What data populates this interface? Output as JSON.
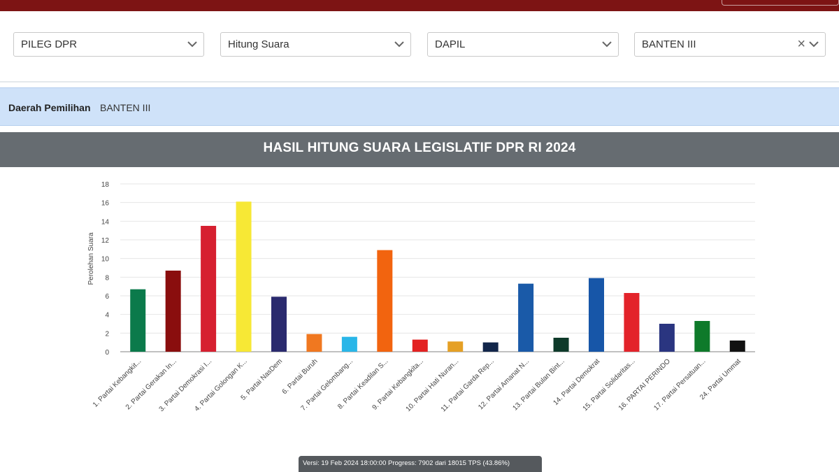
{
  "filters": [
    {
      "value": "PILEG DPR",
      "clearable": false
    },
    {
      "value": "Hitung Suara",
      "clearable": false
    },
    {
      "value": "DAPIL",
      "clearable": false
    },
    {
      "value": "BANTEN III",
      "clearable": true
    }
  ],
  "dapil": {
    "label": "Daerah Pemilihan",
    "value": "BANTEN III"
  },
  "title": "HASIL HITUNG SUARA LEGISLATIF DPR RI 2024",
  "chart_data": {
    "type": "bar",
    "ylabel": "Perolehan Suara",
    "xlabel": "",
    "ylim": [
      0,
      18
    ],
    "yticks": [
      0,
      2,
      4,
      6,
      8,
      10,
      12,
      14,
      16,
      18
    ],
    "grid": true,
    "categories": [
      "1. Partai Kebangkit...",
      "2. Partai Gerakan In...",
      "3. Partai Demokrasi I...",
      "4. Partai Golongan K...",
      "5. Partai NasDem",
      "6. Partai Buruh",
      "7. Partai Gelombang...",
      "8. Partai Keadilan S...",
      "9. Partai Kebangkita...",
      "10. Partai Hati Nuran...",
      "11. Partai Garda Rep...",
      "12. Partai Amanat N...",
      "13. Partai Bulan Bint...",
      "14. Partai Demokrat",
      "15. Partai Solidaritas...",
      "16. PARTAI PERINDO",
      "17. Partai Persatuan...",
      "24. Partai Ummat"
    ],
    "values": [
      6.7,
      8.7,
      13.5,
      16.1,
      5.9,
      1.9,
      1.6,
      10.9,
      1.3,
      1.1,
      1.0,
      7.3,
      1.5,
      7.9,
      6.3,
      3.0,
      3.3,
      1.2
    ],
    "colors": [
      "#0b7a4b",
      "#8a0e0e",
      "#d62030",
      "#f7e835",
      "#2a2a6e",
      "#f07820",
      "#29b6e8",
      "#f2640f",
      "#e32222",
      "#e5a025",
      "#12264a",
      "#1a5aa8",
      "#0e3a2a",
      "#1756a8",
      "#e3232a",
      "#2a3580",
      "#0e7a2a",
      "#111111"
    ]
  },
  "status": "Versi: 19 Feb 2024 18:00:00 Progress: 7902 dari 18015 TPS (43.86%)"
}
